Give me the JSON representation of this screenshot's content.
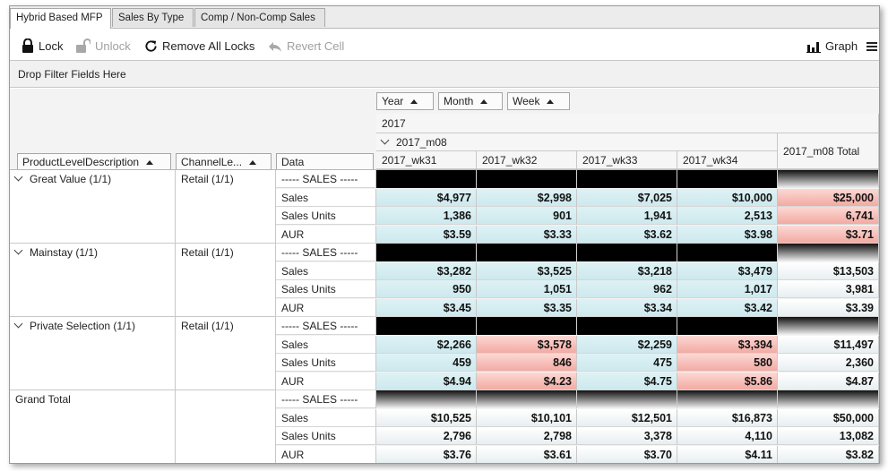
{
  "tabs": [
    {
      "label": "Hybrid Based MFP",
      "active": true
    },
    {
      "label": "Sales By Type",
      "active": false
    },
    {
      "label": "Comp / Non-Comp Sales",
      "active": false
    }
  ],
  "toolbar": {
    "lock": "Lock",
    "unlock": "Unlock",
    "remove_all_locks": "Remove All Locks",
    "revert_cell": "Revert Cell",
    "graph": "Graph"
  },
  "filter_bar": "Drop Filter Fields Here",
  "pivot": {
    "col_fields": [
      "Year",
      "Month",
      "Week"
    ],
    "year": "2017",
    "month": "2017_m08",
    "weeks": [
      "2017_wk31",
      "2017_wk32",
      "2017_wk33",
      "2017_wk34"
    ],
    "total_header": "2017_m08 Total",
    "row_fields": [
      "ProductLevelDescription",
      "ChannelLe...",
      "Data"
    ],
    "groups": [
      {
        "product": "Great Value (1/1)",
        "channel": "Retail (1/1)",
        "section": "----- SALES -----",
        "rows": [
          {
            "label": "Sales",
            "values": [
              "$4,977",
              "$2,998",
              "$7,025",
              "$10,000"
            ],
            "total": "$25,000",
            "colors": [
              "blue",
              "blue",
              "blue",
              "blue"
            ],
            "total_color": "pink"
          },
          {
            "label": "Sales Units",
            "values": [
              "1,386",
              "901",
              "1,941",
              "2,513"
            ],
            "total": "6,741",
            "colors": [
              "blue",
              "blue",
              "blue",
              "blue"
            ],
            "total_color": "pink"
          },
          {
            "label": "AUR",
            "values": [
              "$3.59",
              "$3.33",
              "$3.62",
              "$3.98"
            ],
            "total": "$3.71",
            "colors": [
              "blue",
              "blue",
              "blue",
              "blue"
            ],
            "total_color": "pink"
          }
        ]
      },
      {
        "product": "Mainstay (1/1)",
        "channel": "Retail (1/1)",
        "section": "----- SALES -----",
        "rows": [
          {
            "label": "Sales",
            "values": [
              "$3,282",
              "$3,525",
              "$3,218",
              "$3,479"
            ],
            "total": "$13,503",
            "colors": [
              "blue",
              "blue",
              "blue",
              "blue"
            ],
            "total_color": "grey"
          },
          {
            "label": "Sales Units",
            "values": [
              "950",
              "1,051",
              "962",
              "1,017"
            ],
            "total": "3,981",
            "colors": [
              "blue",
              "blue",
              "blue",
              "blue"
            ],
            "total_color": "grey"
          },
          {
            "label": "AUR",
            "values": [
              "$3.45",
              "$3.35",
              "$3.34",
              "$3.42"
            ],
            "total": "$3.39",
            "colors": [
              "blue",
              "blue",
              "blue",
              "blue"
            ],
            "total_color": "grey"
          }
        ]
      },
      {
        "product": "Private Selection (1/1)",
        "channel": "Retail (1/1)",
        "section": "----- SALES -----",
        "rows": [
          {
            "label": "Sales",
            "values": [
              "$2,266",
              "$3,578",
              "$2,259",
              "$3,394"
            ],
            "total": "$11,497",
            "colors": [
              "blue",
              "pink",
              "blue",
              "pink"
            ],
            "total_color": "grey"
          },
          {
            "label": "Sales Units",
            "values": [
              "459",
              "846",
              "475",
              "580"
            ],
            "total": "2,360",
            "colors": [
              "blue",
              "pink",
              "blue",
              "pink"
            ],
            "total_color": "grey"
          },
          {
            "label": "AUR",
            "values": [
              "$4.94",
              "$4.23",
              "$4.75",
              "$5.86"
            ],
            "total": "$4.87",
            "colors": [
              "blue",
              "pink",
              "blue",
              "pink"
            ],
            "total_color": "grey"
          }
        ]
      },
      {
        "product": "Grand Total",
        "channel": "",
        "section": "----- SALES -----",
        "rows": [
          {
            "label": "Sales",
            "values": [
              "$10,525",
              "$10,101",
              "$12,501",
              "$16,873"
            ],
            "total": "$50,000",
            "colors": [
              "grey",
              "grey",
              "grey",
              "grey"
            ],
            "total_color": "grey"
          },
          {
            "label": "Sales Units",
            "values": [
              "2,796",
              "2,798",
              "3,378",
              "4,110"
            ],
            "total": "13,082",
            "colors": [
              "grey",
              "grey",
              "grey",
              "grey"
            ],
            "total_color": "grey"
          },
          {
            "label": "AUR",
            "values": [
              "$3.76",
              "$3.61",
              "$3.70",
              "$4.11"
            ],
            "total": "$3.82",
            "colors": [
              "grey",
              "grey",
              "grey",
              "grey"
            ],
            "total_color": "grey"
          }
        ]
      }
    ]
  },
  "colors": {
    "blue": "#d4edf1",
    "pink": "#f5b7b0",
    "black": "#000000"
  }
}
